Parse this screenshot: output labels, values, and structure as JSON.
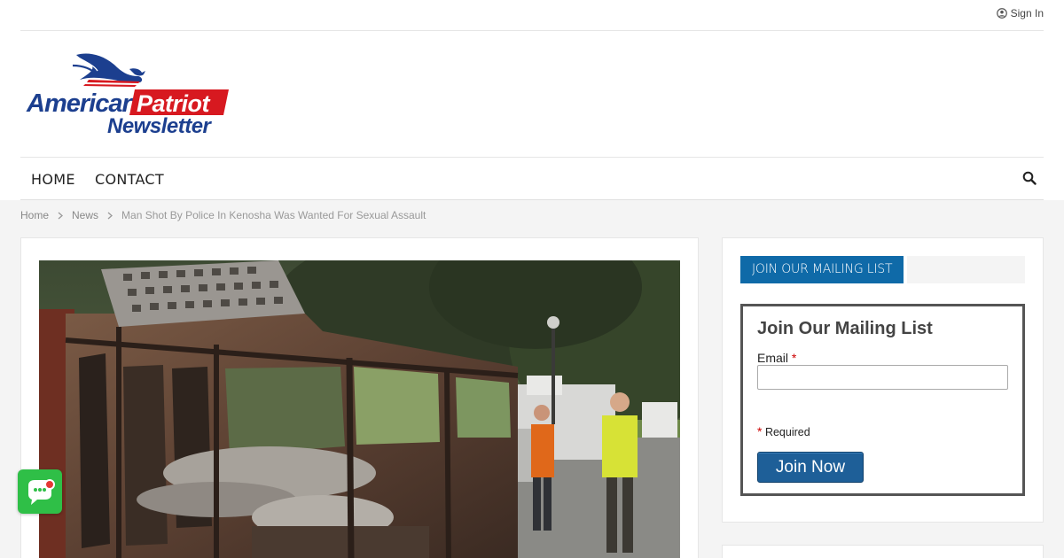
{
  "header": {
    "signin_label": "Sign In",
    "logo": {
      "line1a": "American",
      "line1b": "Patriot",
      "line2": "Newsletter"
    }
  },
  "nav": {
    "items": [
      {
        "label": "HOME"
      },
      {
        "label": "CONTACT"
      }
    ]
  },
  "breadcrumb": {
    "items": [
      "Home",
      "News"
    ],
    "current": "Man Shot By Police In Kenosha Was Wanted For Sexual Assault"
  },
  "sidebar": {
    "widget_tab": "JOIN OUR MAILING LIST",
    "mailing_form": {
      "title": "Join Our Mailing List",
      "email_label": "Email",
      "required_mark": "*",
      "required_note": "Required",
      "email_value": "",
      "submit_label": "Join Now"
    }
  },
  "colors": {
    "accent": "#0f6aa8",
    "logo_red": "#d71920",
    "logo_blue": "#1c3f8f",
    "chat_green": "#2fbf47"
  },
  "icons": {
    "signin": "user-circle-icon",
    "search": "search-icon",
    "breadcrumb_separator": "chevron-right-icon",
    "chat": "chat-bubble-icon"
  }
}
